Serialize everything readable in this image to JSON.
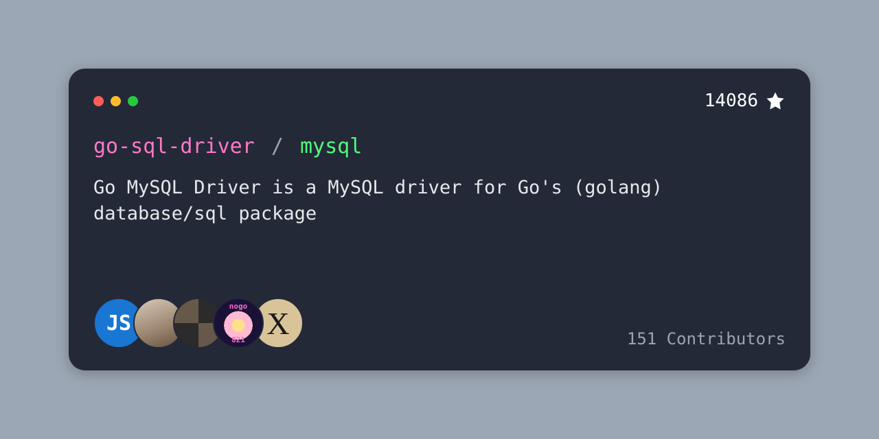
{
  "stars": "14086",
  "title": {
    "org": "go-sql-driver",
    "sep": "/",
    "repo": "mysql"
  },
  "description": "Go MySQL Driver is a MySQL driver for Go's (golang) database/sql package",
  "avatars": [
    {
      "label": "JS"
    },
    {
      "label": ""
    },
    {
      "label": ""
    },
    {
      "label": ""
    },
    {
      "label": "X"
    }
  ],
  "contributors_text": "151 Contributors",
  "traffic": {
    "close": "close-icon",
    "minimize": "minimize-icon",
    "zoom": "zoom-icon"
  }
}
